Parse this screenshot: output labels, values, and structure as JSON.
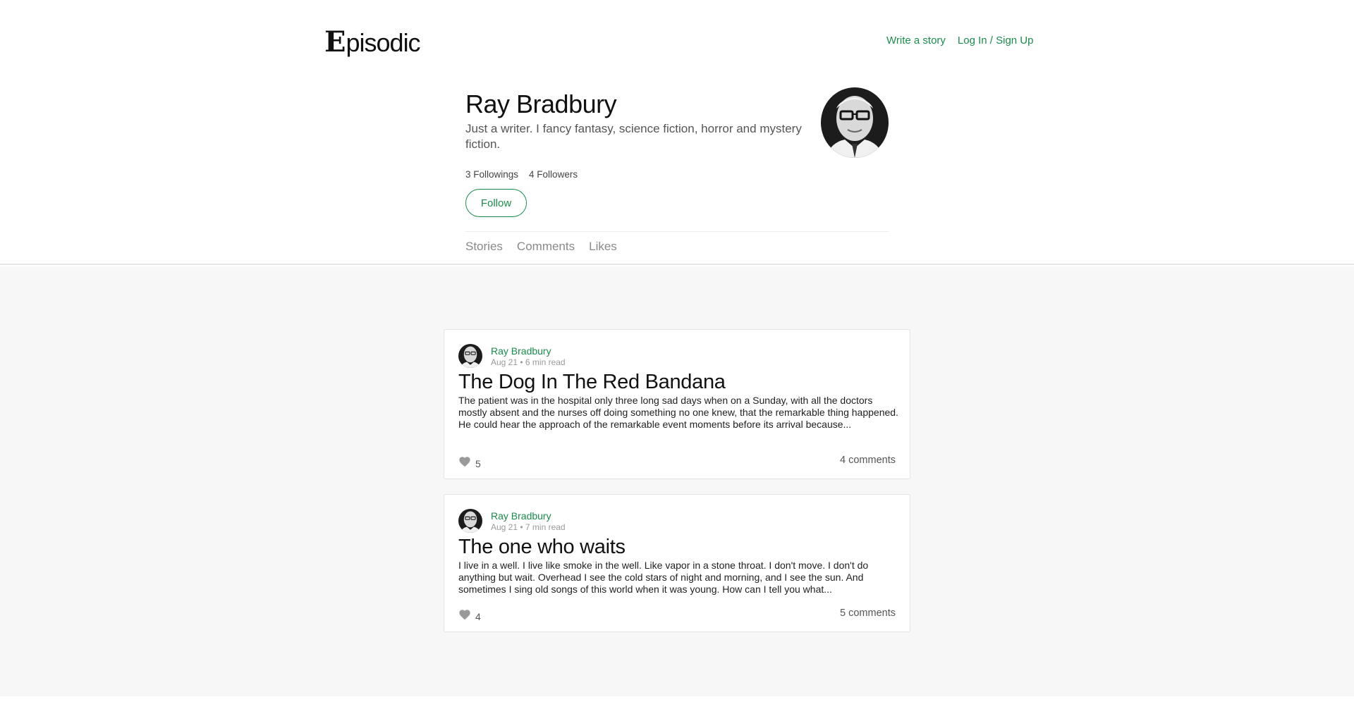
{
  "brand": {
    "logo_initial": "E",
    "logo_rest": "pisodic"
  },
  "nav": {
    "write_story": "Write a story",
    "login_signup": "Log In / Sign Up"
  },
  "profile": {
    "name": "Ray Bradbury",
    "bio": "Just a writer. I fancy fantasy, science fiction, horror and mystery fiction.",
    "followings": "3 Followings",
    "followers": "4 Followers",
    "follow_label": "Follow"
  },
  "tabs": [
    "Stories",
    "Comments",
    "Likes"
  ],
  "stories": [
    {
      "author": "Ray Bradbury",
      "meta": "Aug 21 • 6 min read",
      "title": "The Dog In The Red Bandana",
      "excerpt": "The patient was in the hospital only three long sad days when on a Sunday, with all the doctors mostly absent and the nurses off doing something no one knew, that the remarkable thing happened. He could hear the approach of the remarkable event moments before its arrival because...",
      "likes": "5",
      "comments": "4 comments"
    },
    {
      "author": "Ray Bradbury",
      "meta": "Aug 21 • 7 min read",
      "title": "The one who waits",
      "excerpt": "I live in a well. I live like smoke in the well. Like vapor in a stone throat. I don't move. I don't do anything but wait. Overhead I see the cold stars of night and morning, and I see the sun. And sometimes I sing old songs of this world when it was young. How can I tell you what...",
      "likes": "4",
      "comments": "5 comments"
    }
  ],
  "colors": {
    "accent": "#1a8c4a",
    "feed_bg": "#f7f7f7",
    "muted": "#8a8a8a"
  }
}
